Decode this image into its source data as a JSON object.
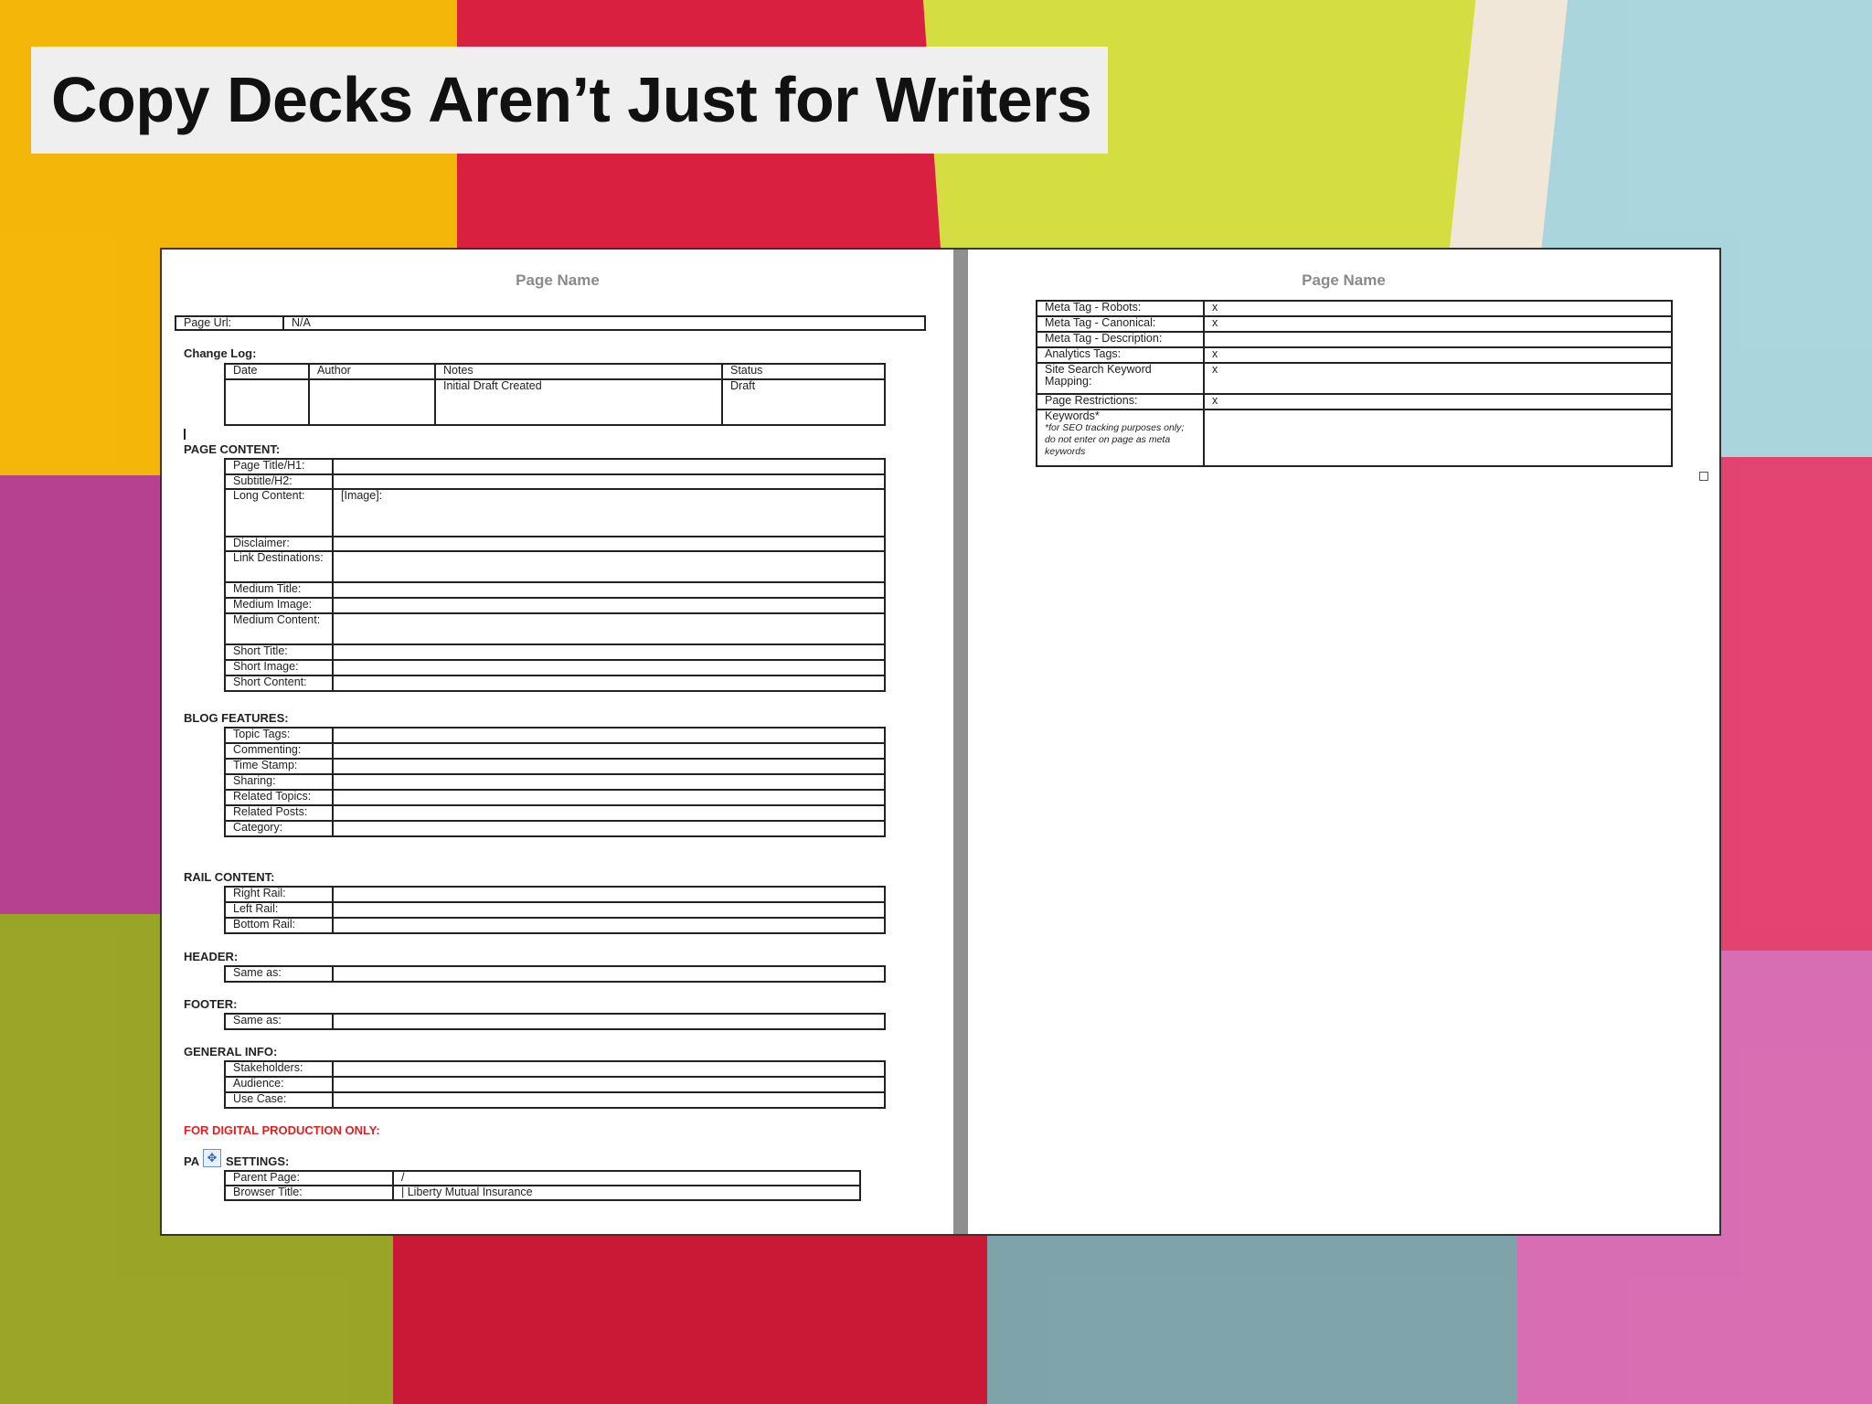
{
  "slide": {
    "title": "Copy Decks Aren’t Just for Writers"
  },
  "left_page": {
    "page_name": "Page Name",
    "page_url": {
      "label": "Page Url:",
      "value": "N/A"
    },
    "change_log": {
      "heading": "Change Log:",
      "headers": [
        "Date",
        "Author",
        "Notes",
        "Status"
      ],
      "row": [
        "",
        "",
        "Initial Draft Created",
        "Draft"
      ]
    },
    "page_content": {
      "heading": "PAGE CONTENT:",
      "rows": [
        {
          "label": "Page Title/H1:",
          "value": ""
        },
        {
          "label": "Subtitle/H2:",
          "value": ""
        },
        {
          "label": "Long Content:",
          "value": "[Image]:"
        },
        {
          "label": "Disclaimer:",
          "value": ""
        },
        {
          "label": "Link Destinations:",
          "value": ""
        },
        {
          "label": "Medium Title:",
          "value": ""
        },
        {
          "label": "Medium Image:",
          "value": ""
        },
        {
          "label": "Medium Content:",
          "value": ""
        },
        {
          "label": "Short Title:",
          "value": ""
        },
        {
          "label": "Short Image:",
          "value": ""
        },
        {
          "label": "Short Content:",
          "value": ""
        }
      ]
    },
    "blog_features": {
      "heading": "BLOG FEATURES:",
      "rows": [
        "Topic Tags:",
        "Commenting:",
        "Time Stamp:",
        "Sharing:",
        "Related Topics:",
        "Related Posts:",
        "Category:"
      ]
    },
    "rail_content": {
      "heading": "RAIL CONTENT:",
      "rows": [
        "Right Rail:",
        "Left Rail:",
        "Bottom Rail:"
      ]
    },
    "header": {
      "heading": "HEADER:",
      "rows": [
        "Same as:"
      ]
    },
    "footer": {
      "heading": "FOOTER:",
      "rows": [
        "Same as:"
      ]
    },
    "general_info": {
      "heading": "GENERAL INFO:",
      "rows": [
        "Stakeholders:",
        "Audience:",
        "Use Case:"
      ]
    },
    "digital_production": {
      "heading": "FOR DIGITAL PRODUCTION ONLY:"
    },
    "page_settings": {
      "heading_start": "PA",
      "heading_end": "SETTINGS:",
      "rows": [
        {
          "label": "Parent Page:",
          "value": "/"
        },
        {
          "label": "Browser Title:",
          "value": "| Liberty Mutual Insurance"
        }
      ]
    }
  },
  "right_page": {
    "page_name": "Page Name",
    "rows": [
      {
        "label": "Meta Tag - Robots:",
        "value": "x"
      },
      {
        "label": "Meta Tag - Canonical:",
        "value": "x"
      },
      {
        "label": "Meta Tag - Description:",
        "value": ""
      },
      {
        "label": "Analytics Tags:",
        "value": "x"
      },
      {
        "label": "Site Search Keyword Mapping:",
        "value": "x"
      },
      {
        "label": "Page Restrictions:",
        "value": "x"
      },
      {
        "label": "Keywords*",
        "note": "*for SEO tracking purposes only; do not enter on page as meta keywords",
        "value": ""
      }
    ]
  },
  "icons": {
    "table_move": "move-arrows-icon",
    "cursor": "text-cursor-icon",
    "resize_handle": "resize-handle-icon"
  },
  "colors": {
    "title_bg": "#efefef",
    "section_red": "#e02020",
    "page_name_gray": "#8a8a8a",
    "background_papers": [
      "#f5b400",
      "#d9173a",
      "#d4dd3a",
      "#a8d4dc",
      "#b23a8c",
      "#e23c6a",
      "#95a21e",
      "#7aa0a8",
      "#d868b0"
    ]
  }
}
